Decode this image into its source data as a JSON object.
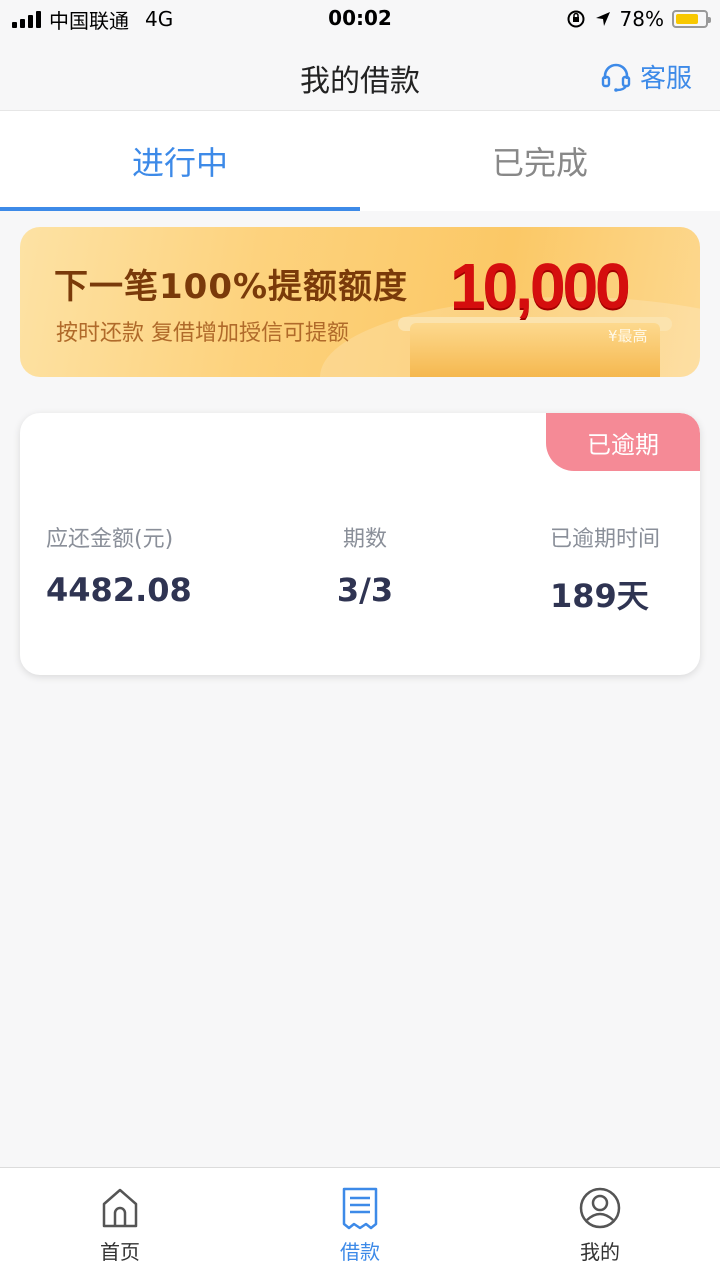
{
  "status_bar": {
    "carrier": "中国联通",
    "network": "4G",
    "time": "00:02",
    "battery": "78%",
    "battery_level": 0.78
  },
  "navbar": {
    "title": "我的借款",
    "service_label": "客服",
    "service_icon": "headset-icon"
  },
  "tabs": [
    {
      "label": "进行中",
      "active": true
    },
    {
      "label": "已完成",
      "active": false
    }
  ],
  "banner": {
    "title": "下一笔100%提额额度",
    "subtitle": "按时还款  复借增加授信可提额",
    "amount": "10,000",
    "max_label": "¥最高"
  },
  "loan_card": {
    "status_badge": "已逾期",
    "amount_label": "应还金额(元)",
    "amount_value": "4482.08",
    "period_label": "期数",
    "period_value": "3/3",
    "overdue_label": "已逾期时间",
    "overdue_value": "189天"
  },
  "tabbar": [
    {
      "label": "首页",
      "icon": "home-icon",
      "active": false
    },
    {
      "label": "借款",
      "icon": "document-icon",
      "active": true
    },
    {
      "label": "我的",
      "icon": "user-icon",
      "active": false
    }
  ],
  "colors": {
    "accent": "#3d8ae8",
    "overdue_badge": "#f58a96",
    "banner_amount": "#d50e0e"
  }
}
